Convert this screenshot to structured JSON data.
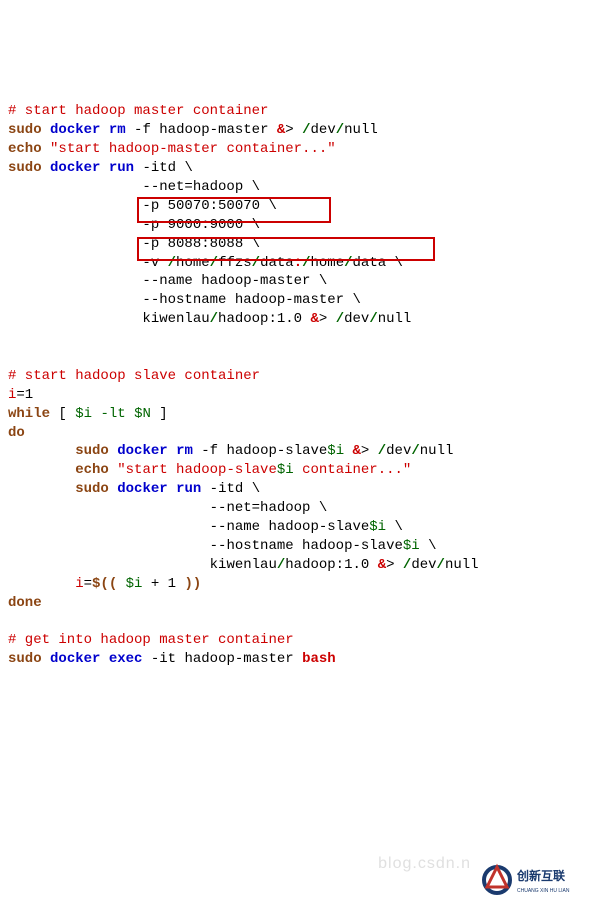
{
  "c1": "# start hadoop master container",
  "sudo": "sudo",
  "docker": "docker",
  "rm": "rm",
  "run": "run",
  "exec": "exec",
  "echo": "echo",
  "while": "while",
  "do": "do",
  "done": "done",
  "bash": "bash",
  "rm_args": " -f hadoop-master ",
  "amp": "&",
  "gt": ">",
  "slash": "/",
  "dev": "dev",
  "null": "null",
  "str_master": "\"start hadoop-master container...\"",
  "itd": " -itd \\",
  "net": "--net=hadoop \\",
  "p1": "-p 50070:50070 \\",
  "p2": "-p 9000:9000 \\",
  "p3": "-p 8088:8088 \\",
  "v1a": "-v ",
  "home": "home",
  "ffzs": "ffzs",
  "data": "data",
  "colon": ":",
  "bs": " \\",
  "name_master": "--name hadoop-master \\",
  "host_master": "--hostname hadoop-master \\",
  "img_a": "kiwenlau",
  "img_b": "hadoop:1.0 ",
  "c2": "# start hadoop slave container",
  "i_assign_l": "i",
  "i_assign_r": "=1",
  "lb": "[ ",
  "si": "$i",
  "lt": " -lt ",
  "sn": "$N",
  "rb": " ]",
  "rm_slave_a": " -f hadoop-slave",
  "str_slave_a": "\"start hadoop-slave",
  "str_slave_b": " container...\"",
  "net2": "--net=hadoop \\",
  "name_slave_a": "--name hadoop-slave",
  "host_slave_a": "--hostname hadoop-slave",
  "incr_a": "i",
  "incr_b": "=",
  "incr_c": "$(( ",
  "incr_d": " + 1 ",
  "incr_e": "))",
  "c3": "# get into hadoop master container",
  "exec_args": " -it hadoop-master ",
  "watermark": "blog.csdn.n",
  "logo_text": "创新互联",
  "logo_sub": "CHUANG XIN HU LIAN"
}
